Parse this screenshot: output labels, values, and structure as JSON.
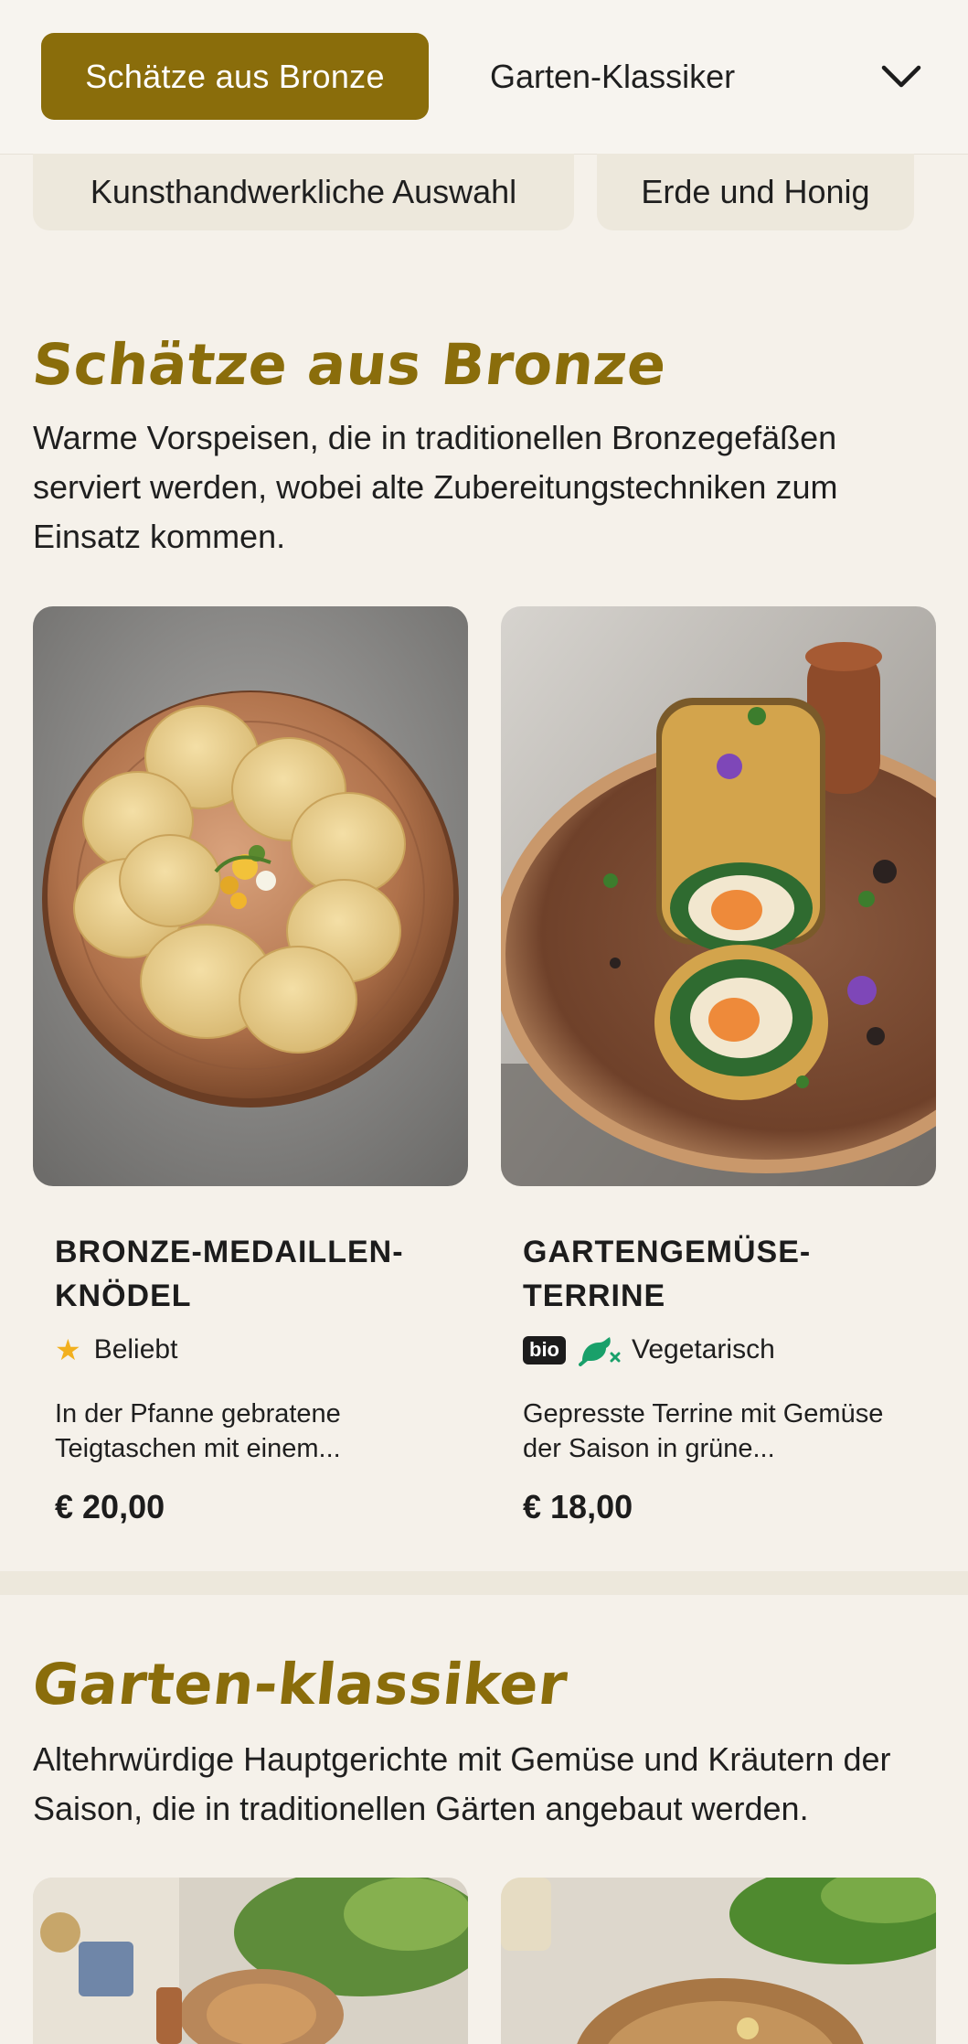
{
  "nav": {
    "active": "Schätze aus Bronze",
    "second": "Garten-Klassiker",
    "row2": [
      "Kunsthandwerkliche Auswahl",
      "Erde und Honig"
    ]
  },
  "sections": [
    {
      "title": "Schätze aus Bronze",
      "description": "Warme Vorspeisen, die in traditionellen Bronzegefäßen serviert werden, wobei alte Zubereitungstechniken zum Einsatz kommen.",
      "items": [
        {
          "name": "BRONZE-MEDAILLEN-KNÖDEL",
          "tag": "Beliebt",
          "description": "In der Pfanne gebratene Teigtaschen mit einem...",
          "price": "€ 20,00"
        },
        {
          "name": "GARTENGEMÜSE-TERRINE",
          "badge": "bio",
          "tag": "Vegetarisch",
          "description": "Gepresste Terrine mit Gemüse der Saison in grüne...",
          "price": "€ 18,00"
        }
      ]
    },
    {
      "title": "Garten-klassiker",
      "description": "Altehrwürdige Hauptgerichte mit Gemüse und Kräutern der Saison, die in traditionellen Gärten angebaut werden."
    }
  ],
  "icons": {
    "chevron": "chevron-down-icon",
    "star": "star-icon",
    "vegetarian": "vegetarian-icon"
  },
  "colors": {
    "accent": "#8a6d0b",
    "background": "#f5f1ea",
    "star": "#f2b01e",
    "veg": "#19a06a"
  }
}
